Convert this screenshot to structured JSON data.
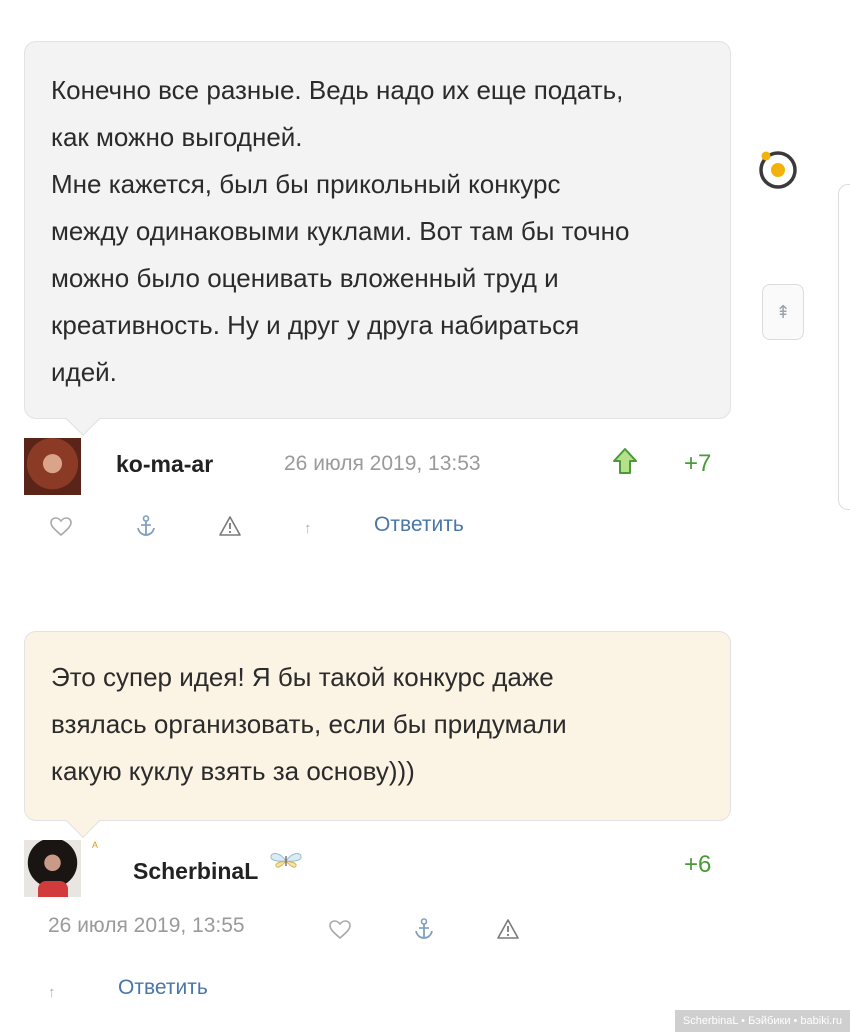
{
  "comment1": {
    "text_lines": [
      "Конечно все разные. Ведь надо их еще подать,",
      "как можно выгодней.",
      "Мне кажется, был бы прикольный конкурс",
      "между одинаковыми куклами. Вот там бы точно",
      "можно было оценивать вложенный труд и",
      "креативность. Ну и друг у друга набираться",
      "идей."
    ],
    "author": "ko-ma-ar",
    "date": "26 июля 2019, 13:53",
    "score": "+7",
    "reply_label": "Ответить",
    "bubble_color": "#f3f3f3"
  },
  "comment2": {
    "text_lines": [
      "Это супер идея! Я бы такой конкурс даже",
      "взялась организовать, если бы придумали",
      "какую куклу взять за основу)))"
    ],
    "author": "ScherbinaL",
    "date": "26 июля 2019, 13:55",
    "score": "+6",
    "reply_label": "Ответить",
    "rank_glyph": "ᴬ",
    "bubble_color": "#fbf3e4"
  },
  "icons": {
    "like": "heart-outline-icon",
    "anchor": "anchor-icon",
    "report": "warning-triangle-icon",
    "parent": "arrow-up-icon",
    "upvote": "upvote-arrow-icon",
    "badge": "butterfly-badge-icon",
    "loading": "loading-ring-icon",
    "scroll": "scroll-top-icon"
  },
  "watermark": "ScherbinaL • Бэйбики • babiki.ru",
  "colors": {
    "score": "#4a9a3a",
    "link": "#4a76a8",
    "accent": "#f2b20a"
  }
}
